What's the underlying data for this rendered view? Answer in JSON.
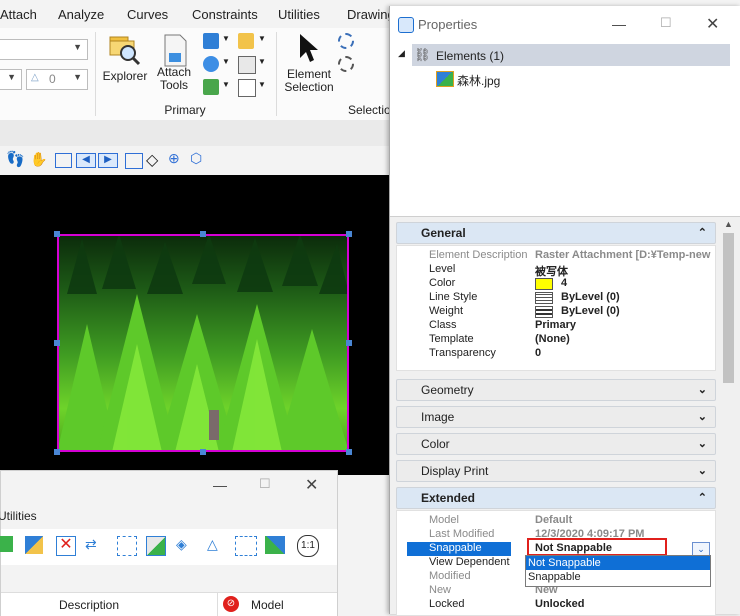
{
  "ribbon": {
    "tabs": [
      "Attach",
      "Analyze",
      "Curves",
      "Constraints",
      "Utilities",
      "Drawing"
    ],
    "explorer_label": "Explorer",
    "attach_tools_line1": "Attach",
    "attach_tools_line2": "Tools",
    "element_selection_line1": "Element",
    "element_selection_line2": "Selection",
    "primary_group": "Primary",
    "selection_group": "Selectio",
    "number_field": "0"
  },
  "dialog": {
    "title_fragment": "Utilities",
    "col_description": "Description",
    "col_model": "Model"
  },
  "properties": {
    "title": "Properties",
    "tree_root": "Elements (1)",
    "tree_child": "森林.jpg",
    "sections": {
      "general": "General",
      "geometry": "Geometry",
      "image": "Image",
      "color": "Color",
      "display_print": "Display Print",
      "extended": "Extended"
    },
    "general_rows": [
      {
        "k": "Element Description",
        "v": "Raster Attachment [D:¥Temp-new"
      },
      {
        "k": "Level",
        "v": "被写体"
      },
      {
        "k": "Color",
        "v": "4"
      },
      {
        "k": "Line Style",
        "v": "ByLevel (0)"
      },
      {
        "k": "Weight",
        "v": "ByLevel (0)"
      },
      {
        "k": "Class",
        "v": "Primary"
      },
      {
        "k": "Template",
        "v": "(None)"
      },
      {
        "k": "Transparency",
        "v": "0"
      }
    ],
    "extended_rows": [
      {
        "k": "Model",
        "v": "Default"
      },
      {
        "k": "Last Modified",
        "v": "12/3/2020 4:09:17 PM"
      },
      {
        "k": "Snappable",
        "v": "Not Snappable"
      },
      {
        "k": "View Dependent",
        "v": ""
      },
      {
        "k": "Modified",
        "v": ""
      },
      {
        "k": "New",
        "v": "New"
      },
      {
        "k": "Locked",
        "v": "Unlocked"
      }
    ],
    "snappable_options": [
      "Not Snappable",
      "Snappable"
    ]
  },
  "colors": {
    "selection_border": "#d400d4",
    "accent_blue": "#0f6fd6",
    "highlight_red": "#e0201c",
    "color_swatch": "#ffff00"
  }
}
